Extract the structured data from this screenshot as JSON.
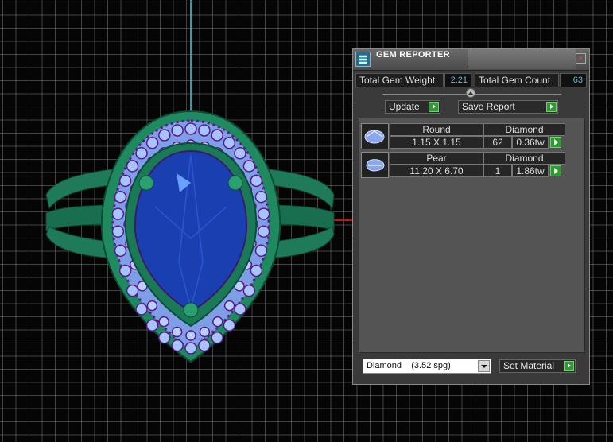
{
  "viewport": {
    "grid_color": "#808080",
    "axis_vertical_color": "#1aa8b8",
    "axis_horizontal_color": "#cc1111",
    "ring_band_color": "#1e7a58",
    "center_stone_color": "#1a3fb0",
    "halo_stone_color": "#9ab8ff",
    "prong_color": "#6a1a9a"
  },
  "panel": {
    "title": "GEM REPORTER",
    "close_icon": "close-icon",
    "total_weight_label": "Total Gem Weight",
    "total_weight_value": "2.21",
    "total_count_label": "Total Gem Count",
    "total_count_value": "63",
    "update_label": "Update",
    "save_report_label": "Save Report",
    "gems": [
      {
        "shape": "Round",
        "material": "Diamond",
        "size": "1.15 X 1.15",
        "count": "62",
        "weight": "0.36tw"
      },
      {
        "shape": "Pear",
        "material": "Diamond",
        "size": "11.20 X 6.70",
        "count": "1",
        "weight": "1.86tw"
      }
    ],
    "material_select": "Diamond    (3.52 spg)",
    "set_material_label": "Set Material"
  }
}
